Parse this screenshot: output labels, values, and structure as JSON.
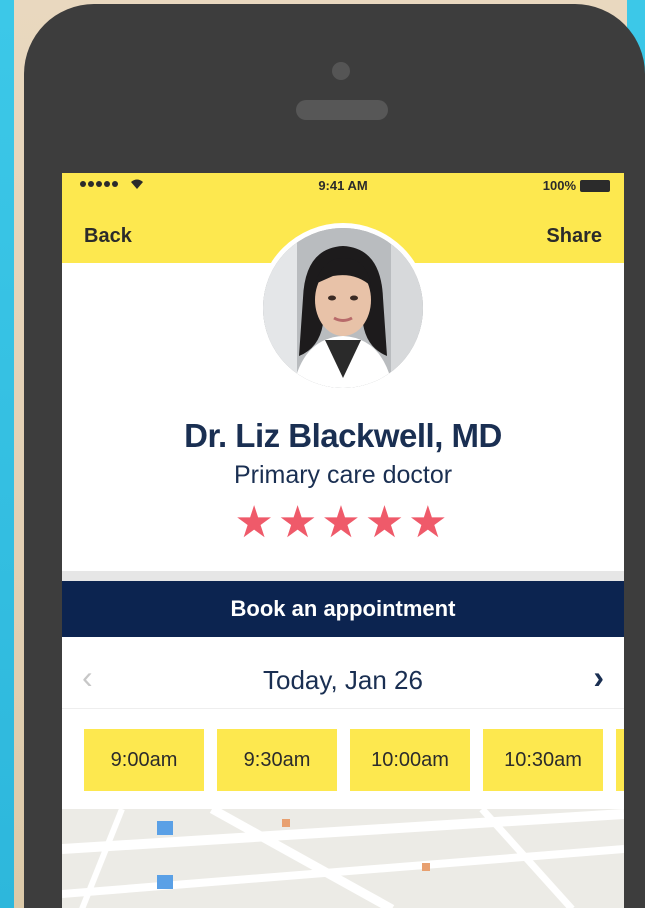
{
  "status_bar": {
    "time": "9:41 AM",
    "battery": "100%",
    "signal_icon": "signal-icon",
    "wifi_icon": "wifi-icon"
  },
  "header": {
    "back_label": "Back",
    "share_label": "Share"
  },
  "profile": {
    "name": "Dr. Liz Blackwell, MD",
    "specialty": "Primary care doctor",
    "rating": 5,
    "rating_max": 5,
    "stars_text": "★★★★★"
  },
  "booking": {
    "button_label": "Book an appointment",
    "date_label": "Today, Jan 26",
    "prev_glyph": "‹",
    "next_glyph": "›",
    "slots": [
      "9:00am",
      "9:30am",
      "10:00am",
      "10:30am"
    ]
  },
  "colors": {
    "header_yellow": "#fde84f",
    "navy": "#0c2450",
    "text_navy": "#1a2f52",
    "star_red": "#ef5a6a",
    "phone_body": "#3d3d3d"
  }
}
